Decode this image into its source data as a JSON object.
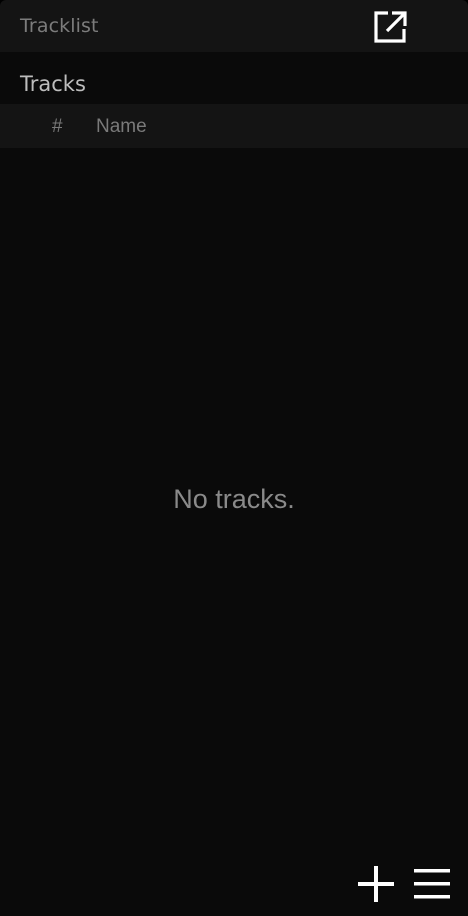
{
  "window": {
    "title": "Tracklist"
  },
  "tracks": {
    "title": "Tracks",
    "columns": [
      "#",
      "Name"
    ],
    "empty_message": "No tracks."
  },
  "icons": {
    "popout": "external-link-icon",
    "add": "plus-icon",
    "menu": "hamburger-menu-icon"
  },
  "colors": {
    "background": "#0a0a0a",
    "header_bar": "#141414",
    "icon": "#ffffff"
  }
}
